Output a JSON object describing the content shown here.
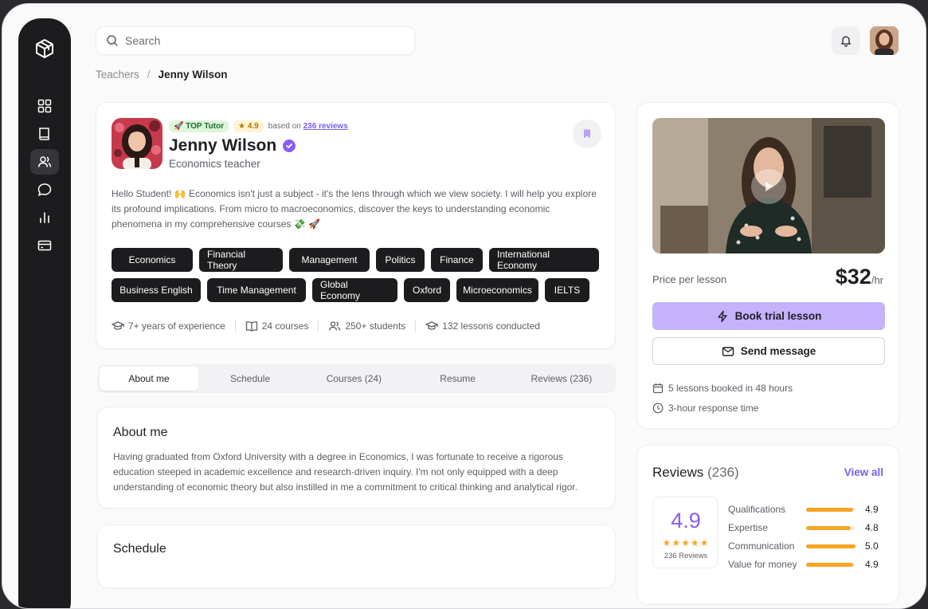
{
  "search": {
    "placeholder": "Search"
  },
  "breadcrumb": {
    "parent": "Teachers",
    "separator": "/",
    "current": "Jenny Wilson"
  },
  "profile": {
    "badge_top": "🚀 TOP Tutor",
    "rating_badge": "★ 4.9",
    "based_on": "based on",
    "reviews_link": "236 reviews",
    "name": "Jenny Wilson",
    "role": "Economics teacher",
    "bio": "Hello Student! 🙌 Economics isn't just a subject - it's the lens through which we view society. I will help you explore its profound implications. From micro to macroeconomics, discover the keys to understanding economic phenomena in my comprehensive courses 💸 🚀",
    "tags": [
      "Economics",
      "Financial Theory",
      "Management",
      "Politics",
      "Finance",
      "International Economy",
      "Business English",
      "Time Management",
      "Global Economy",
      "Oxford",
      "Microeconomics",
      "IELTS"
    ],
    "stats": {
      "experience": "7+ years of experience",
      "courses": "24 courses",
      "students": "250+ students",
      "lessons": "132 lessons conducted"
    }
  },
  "tabs": [
    "About me",
    "Schedule",
    "Courses (24)",
    "Resume",
    "Reviews (236)"
  ],
  "active_tab": "About me",
  "about": {
    "title": "About me",
    "text": "Having graduated from Oxford University with a degree in Economics, I was fortunate to receive a rigorous education steeped in academic excellence and research-driven inquiry. I'm not only equipped with a deep understanding of economic theory but also instilled in me a commitment to critical thinking and analytical rigor."
  },
  "schedule": {
    "title": "Schedule"
  },
  "booking": {
    "price_label": "Price per lesson",
    "price": "$32",
    "price_unit": "/hr",
    "trial_button": "Book trial lesson",
    "message_button": "Send message",
    "booked_info": "5 lessons booked in 48 hours",
    "response_info": "3-hour response time"
  },
  "reviews": {
    "title": "Reviews",
    "count": "(236)",
    "view_all": "View all",
    "score": "4.9",
    "stars": "★★★★★",
    "total": "236 Reviews",
    "ratings": [
      {
        "label": "Qualifications",
        "value": "4.9",
        "fraction": 0.95
      },
      {
        "label": "Expertise",
        "value": "4.8",
        "fraction": 0.9
      },
      {
        "label": "Communication",
        "value": "5.0",
        "fraction": 1.0
      },
      {
        "label": "Value for money",
        "value": "4.9",
        "fraction": 0.95
      }
    ]
  },
  "colors": {
    "accent": "#8b5cf6",
    "trial_button": "#c4b3fb",
    "star": "#f5a623",
    "sidebar": "#1c1c1f"
  }
}
